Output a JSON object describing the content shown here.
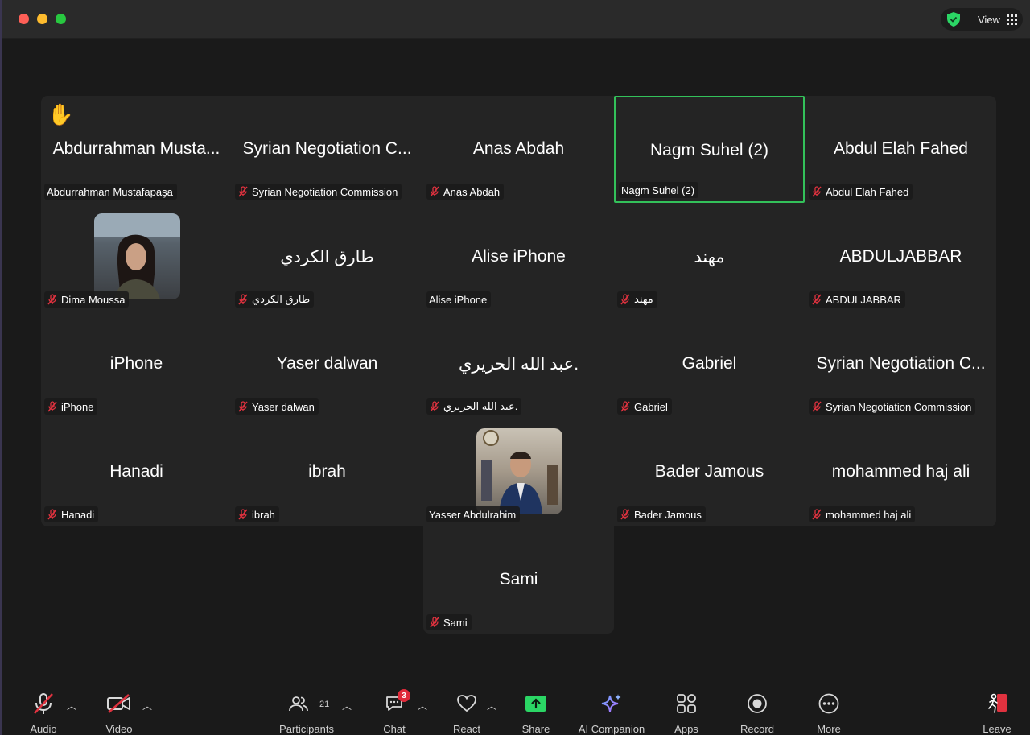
{
  "window": {
    "view_label": "View"
  },
  "tiles": [
    {
      "display_name": "Abdurrahman Musta...",
      "label": "Abdurrahman Mustafapaşa",
      "muted": false,
      "raised_hand": true
    },
    {
      "display_name": "Syrian Negotiation C...",
      "label": "Syrian Negotiation Commission",
      "muted": true
    },
    {
      "display_name": "Anas Abdah",
      "label": "Anas Abdah",
      "muted": true
    },
    {
      "display_name": "Nagm Suhel (2)",
      "label": "Nagm Suhel (2)",
      "muted": false,
      "active_speaker": true
    },
    {
      "display_name": "Abdul Elah Fahed",
      "label": "Abdul Elah Fahed",
      "muted": true
    },
    {
      "display_name": "",
      "label": "Dima Moussa",
      "muted": true,
      "has_photo": true
    },
    {
      "display_name": "طارق الكردي",
      "label": "طارق الكردي",
      "muted": true
    },
    {
      "display_name": "Alise iPhone",
      "label": "Alise iPhone",
      "muted": false
    },
    {
      "display_name": "مهند",
      "label": "مهند",
      "muted": true
    },
    {
      "display_name": "ABDULJABBAR",
      "label": "ABDULJABBAR",
      "muted": true
    },
    {
      "display_name": "iPhone",
      "label": "iPhone",
      "muted": true
    },
    {
      "display_name": "Yaser dalwan",
      "label": "Yaser dalwan",
      "muted": true
    },
    {
      "display_name": "عبد الله الحريري.",
      "label": "عبد الله الحريري.",
      "muted": true
    },
    {
      "display_name": "Gabriel",
      "label": "Gabriel",
      "muted": true
    },
    {
      "display_name": "Syrian Negotiation C...",
      "label": "Syrian Negotiation Commission",
      "muted": true
    },
    {
      "display_name": "Hanadi",
      "label": "Hanadi",
      "muted": true
    },
    {
      "display_name": "ibrah",
      "label": "ibrah",
      "muted": true
    },
    {
      "display_name": "",
      "label": "Yasser Abdulrahim",
      "muted": false,
      "has_photo": true
    },
    {
      "display_name": "Bader Jamous",
      "label": "Bader Jamous",
      "muted": true
    },
    {
      "display_name": "mohammed haj ali",
      "label": "mohammed haj ali",
      "muted": true
    }
  ],
  "extra_tile": {
    "display_name": "Sami",
    "label": "Sami",
    "muted": true
  },
  "toolbar": {
    "audio": "Audio",
    "video": "Video",
    "participants": "Participants",
    "participants_count": "21",
    "chat": "Chat",
    "chat_badge": "3",
    "react": "React",
    "share": "Share",
    "ai_companion": "AI Companion",
    "apps": "Apps",
    "record": "Record",
    "more": "More",
    "leave": "Leave"
  },
  "colors": {
    "active_speaker_border": "#33c15a",
    "mute_red": "#e0323f",
    "share_green": "#2bd665",
    "leave_red": "#e0323f"
  }
}
